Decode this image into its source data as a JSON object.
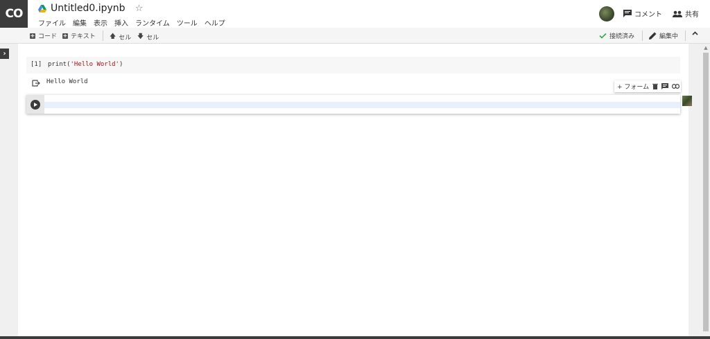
{
  "app": {
    "logo_text": "CO"
  },
  "header": {
    "title": "Untitled0.ipynb",
    "star_glyph": "☆",
    "menu": [
      "ファイル",
      "編集",
      "表示",
      "挿入",
      "ランタイム",
      "ツール",
      "ヘルプ"
    ],
    "comment_label": "コメント",
    "share_label": "共有"
  },
  "toolbar": {
    "add_code": "コード",
    "add_text": "テキスト",
    "cell_up": "セル",
    "cell_down": "セル",
    "connected": "接続済み",
    "editing": "編集中"
  },
  "cells": [
    {
      "exec_count": "[1]",
      "code_prefix": "print(",
      "code_string": "'Hello World'",
      "code_suffix": ")",
      "output": "Hello World"
    }
  ],
  "cell_toolbar": {
    "form_label": "+ フォーム"
  },
  "colors": {
    "accent_green": "#34a853",
    "dark": "#3c3c3c",
    "string": "#a31515"
  }
}
